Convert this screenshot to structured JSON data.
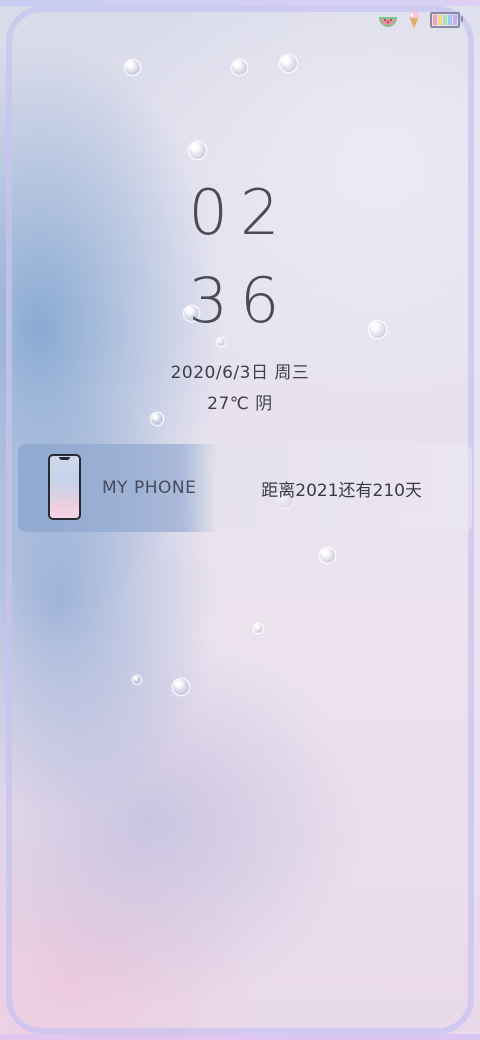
{
  "status_bar": {
    "icons": [
      "watermelon-icon",
      "ice-cream-icon",
      "battery-icon"
    ],
    "battery_colors": [
      "#f3a3b5",
      "#f7d58e",
      "#a6e3b4",
      "#9fc8f1",
      "#c9b0f1"
    ]
  },
  "clock": {
    "hours": "02",
    "minutes": "36"
  },
  "date": "2020/6/3日 周三",
  "weather": "27℃ 阴",
  "widget": {
    "title": "MY PHONE",
    "countdown": "距离2021还有210天"
  },
  "colors": {
    "frame": "#c9c2f0",
    "text": "#4b4b55"
  }
}
